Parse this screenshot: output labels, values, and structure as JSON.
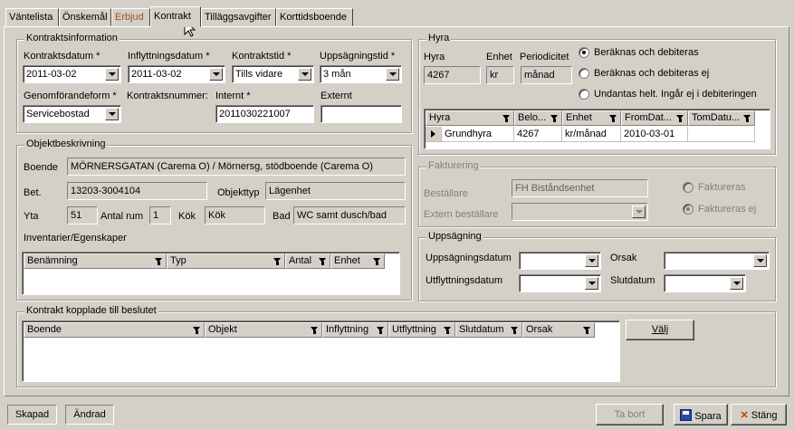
{
  "tabs": [
    "Väntelista",
    "Önskemål",
    "Erbjud",
    "Kontrakt",
    "Tilläggsavgifter",
    "Korttidsboende"
  ],
  "kontrakt": {
    "group_title": "Kontraktsinformation",
    "kontraktsdatum_label": "Kontraktsdatum *",
    "kontraktsdatum": "2011-03-02",
    "inflyttningsdatum_label": "Inflyttningsdatum *",
    "inflyttningsdatum": "2011-03-02",
    "kontraktstid_label": "Kontraktstid *",
    "kontraktstid": "Tills vidare",
    "uppsagningstid_label": "Uppsägningstid *",
    "uppsagningstid": "3 mån",
    "genomforandeform_label": "Genomförandeform *",
    "genomforandeform": "Servicebostad",
    "kontraktsnummer_label": "Kontraktsnummer:",
    "internt_label": "Internt *",
    "internt": "2011030221007",
    "externt_label": "Externt",
    "externt": ""
  },
  "objekt": {
    "group_title": "Objektbeskrivning",
    "boende_label": "Boende",
    "boende": "MÖRNERSGATAN (Carema O) / Mörnersg, stödboende (Carema O)",
    "bet_label": "Bet.",
    "bet": "13203-3004104",
    "objekttyp_label": "Objekttyp",
    "objekttyp": "Lägenhet",
    "yta_label": "Yta",
    "yta": "51",
    "antal_rum_label": "Antal rum",
    "antal_rum": "1",
    "kok_label": "Kök",
    "kok": "Kök",
    "bad_label": "Bad",
    "bad": "WC samt dusch/bad",
    "inventarier_label": "Inventarier/Egenskaper",
    "inventarier_columns": [
      "Benämning",
      "Typ",
      "Antal",
      "Enhet"
    ]
  },
  "hyra": {
    "group_title": "Hyra",
    "hyra_label": "Hyra",
    "hyra": "4267",
    "enhet_label": "Enhet",
    "enhet": "kr",
    "periodicitet_label": "Periodicitet",
    "periodicitet": "månad",
    "radio_options": [
      "Beräknas och debiteras",
      "Beräknas och debiteras ej",
      "Undantas helt. Ingår ej i debiteringen"
    ],
    "columns": [
      "Hyra",
      "Belo...",
      "Enhet",
      "FromDat...",
      "TomDatu..."
    ],
    "rows": [
      {
        "hyra": "Grundhyra",
        "belopp": "4267",
        "enhet": "kr/månad",
        "from": "2010-03-01",
        "tom": ""
      }
    ]
  },
  "fakturering": {
    "group_title": "Fakturering",
    "bestallare_label": "Beställare",
    "bestallare": "FH Biståndsenhet",
    "extern_bestallare_label": "Extern beställare",
    "faktureras_label": "Faktureras",
    "faktureras_ej_label": "Faktureras ej"
  },
  "uppsagning": {
    "group_title": "Uppsägning",
    "uppsagningsdatum_label": "Uppsägningsdatum",
    "orsak_label": "Orsak",
    "utflyttningsdatum_label": "Utflyttningsdatum",
    "slutdatum_label": "Slutdatum"
  },
  "kopplade": {
    "group_title": "Kontrakt kopplade till beslutet",
    "columns": [
      "Boende",
      "Objekt",
      "Inflyttning",
      "Utflyttning",
      "Slutdatum",
      "Orsak"
    ],
    "valj_label": "Välj"
  },
  "footer": {
    "skapad": "Skapad",
    "andrad": "Ändrad",
    "ta_bort": "Ta bort",
    "spara": "Spara",
    "stang": "Stäng"
  }
}
